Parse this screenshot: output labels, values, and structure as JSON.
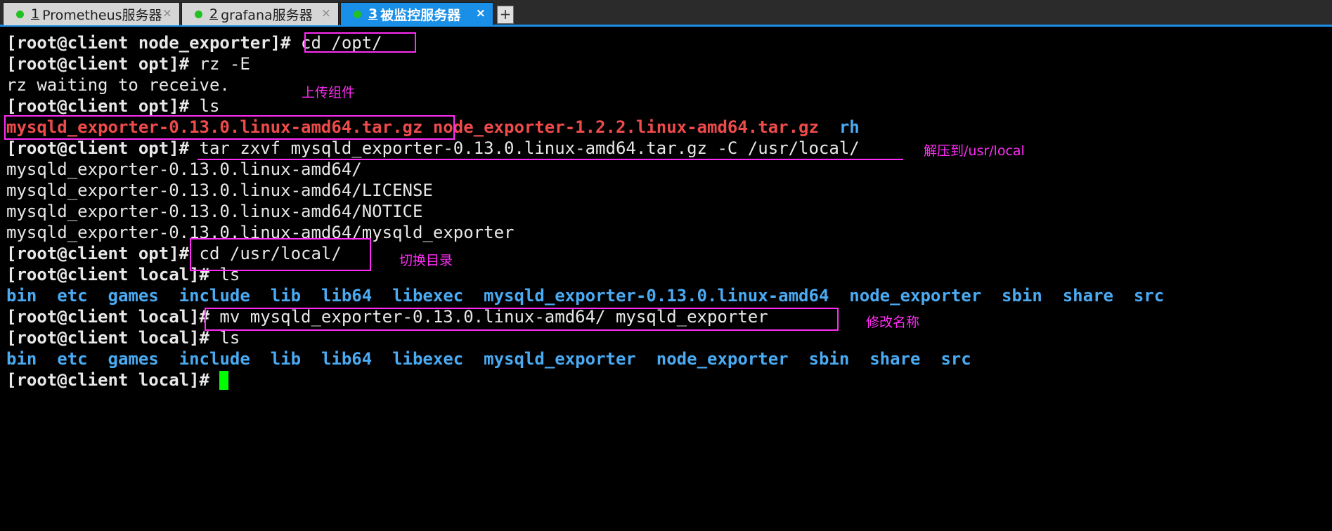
{
  "tabs": [
    {
      "num": "1",
      "label": "Prometheus服务器",
      "active": false
    },
    {
      "num": "2",
      "label": "grafana服务器",
      "active": false
    },
    {
      "num": "3",
      "label": "被监控服务器",
      "active": true
    }
  ],
  "tab_close_glyph": "×",
  "tab_add_glyph": "+",
  "colors": {
    "background": "#000000",
    "text": "#e8e8e8",
    "directory": "#4aaaf2",
    "archive": "#ef4b4b",
    "cursor": "#00ff00",
    "annotation": "#ff2cf5",
    "active_tab": "#1a8fe8",
    "status_dot": "#22c122"
  },
  "terminal": {
    "lines": [
      {
        "segments": [
          {
            "text": "[root@client node_exporter]#",
            "kind": "prompt"
          },
          {
            "text": "cd /opt/",
            "kind": "cmd"
          }
        ]
      },
      {
        "segments": [
          {
            "text": "[root@client opt]#",
            "kind": "prompt"
          },
          {
            "text": "rz -E",
            "kind": "cmd"
          }
        ]
      },
      {
        "segments": [
          {
            "text": "rz waiting to receive.",
            "kind": "out"
          }
        ]
      },
      {
        "segments": [
          {
            "text": "[root@client opt]#",
            "kind": "prompt"
          },
          {
            "text": "ls",
            "kind": "cmd"
          }
        ]
      },
      {
        "segments": [
          {
            "text": "mysqld_exporter-0.13.0.linux-amd64.tar.gz",
            "kind": "arch"
          },
          {
            "text": "node_exporter-1.2.2.linux-amd64.tar.gz",
            "kind": "arch"
          },
          {
            "text": "rh",
            "kind": "dir",
            "gap": 2
          }
        ]
      },
      {
        "segments": [
          {
            "text": "[root@client opt]#",
            "kind": "prompt"
          },
          {
            "text": "tar zxvf mysqld_exporter-0.13.0.linux-amd64.tar.gz -C /usr/local/",
            "kind": "cmd"
          }
        ]
      },
      {
        "segments": [
          {
            "text": "mysqld_exporter-0.13.0.linux-amd64/",
            "kind": "out"
          }
        ]
      },
      {
        "segments": [
          {
            "text": "mysqld_exporter-0.13.0.linux-amd64/LICENSE",
            "kind": "out"
          }
        ]
      },
      {
        "segments": [
          {
            "text": "mysqld_exporter-0.13.0.linux-amd64/NOTICE",
            "kind": "out"
          }
        ]
      },
      {
        "segments": [
          {
            "text": "mysqld_exporter-0.13.0.linux-amd64/mysqld_exporter",
            "kind": "out"
          }
        ]
      },
      {
        "segments": [
          {
            "text": "[root@client opt]#",
            "kind": "prompt"
          },
          {
            "text": "cd /usr/local/",
            "kind": "cmd"
          }
        ]
      },
      {
        "segments": [
          {
            "text": "[root@client local]#",
            "kind": "prompt"
          },
          {
            "text": "ls",
            "kind": "cmd"
          }
        ]
      },
      {
        "segments": [
          {
            "text": "bin",
            "kind": "dir"
          },
          {
            "text": "etc",
            "kind": "dir",
            "gap": 2
          },
          {
            "text": "games",
            "kind": "dir",
            "gap": 2
          },
          {
            "text": "include",
            "kind": "dir",
            "gap": 2
          },
          {
            "text": "lib",
            "kind": "dir",
            "gap": 2
          },
          {
            "text": "lib64",
            "kind": "dir",
            "gap": 2
          },
          {
            "text": "libexec",
            "kind": "dir",
            "gap": 2
          },
          {
            "text": "mysqld_exporter-0.13.0.linux-amd64",
            "kind": "dir",
            "gap": 2
          },
          {
            "text": "node_exporter",
            "kind": "dir",
            "gap": 2
          },
          {
            "text": "sbin",
            "kind": "dir",
            "gap": 2
          },
          {
            "text": "share",
            "kind": "dir",
            "gap": 2
          },
          {
            "text": "src",
            "kind": "dir",
            "gap": 2
          }
        ]
      },
      {
        "segments": [
          {
            "text": "[root@client local]#",
            "kind": "prompt"
          },
          {
            "text": "mv mysqld_exporter-0.13.0.linux-amd64/ mysqld_exporter",
            "kind": "cmd"
          }
        ]
      },
      {
        "segments": [
          {
            "text": "[root@client local]#",
            "kind": "prompt"
          },
          {
            "text": "ls",
            "kind": "cmd"
          }
        ]
      },
      {
        "segments": [
          {
            "text": "bin",
            "kind": "dir"
          },
          {
            "text": "etc",
            "kind": "dir",
            "gap": 2
          },
          {
            "text": "games",
            "kind": "dir",
            "gap": 2
          },
          {
            "text": "include",
            "kind": "dir",
            "gap": 2
          },
          {
            "text": "lib",
            "kind": "dir",
            "gap": 2
          },
          {
            "text": "lib64",
            "kind": "dir",
            "gap": 2
          },
          {
            "text": "libexec",
            "kind": "dir",
            "gap": 2
          },
          {
            "text": "mysqld_exporter",
            "kind": "dir",
            "gap": 2
          },
          {
            "text": "node_exporter",
            "kind": "dir",
            "gap": 2
          },
          {
            "text": "sbin",
            "kind": "dir",
            "gap": 2
          },
          {
            "text": "share",
            "kind": "dir",
            "gap": 2
          },
          {
            "text": "src",
            "kind": "dir",
            "gap": 2
          }
        ]
      },
      {
        "segments": [
          {
            "text": "[root@client local]#",
            "kind": "prompt"
          }
        ],
        "cursor": true
      }
    ]
  },
  "annotations": {
    "upload": "上传组件",
    "extract": "解压到/usr/local",
    "switch_dir": "切换目录",
    "rename": "修改名称"
  }
}
